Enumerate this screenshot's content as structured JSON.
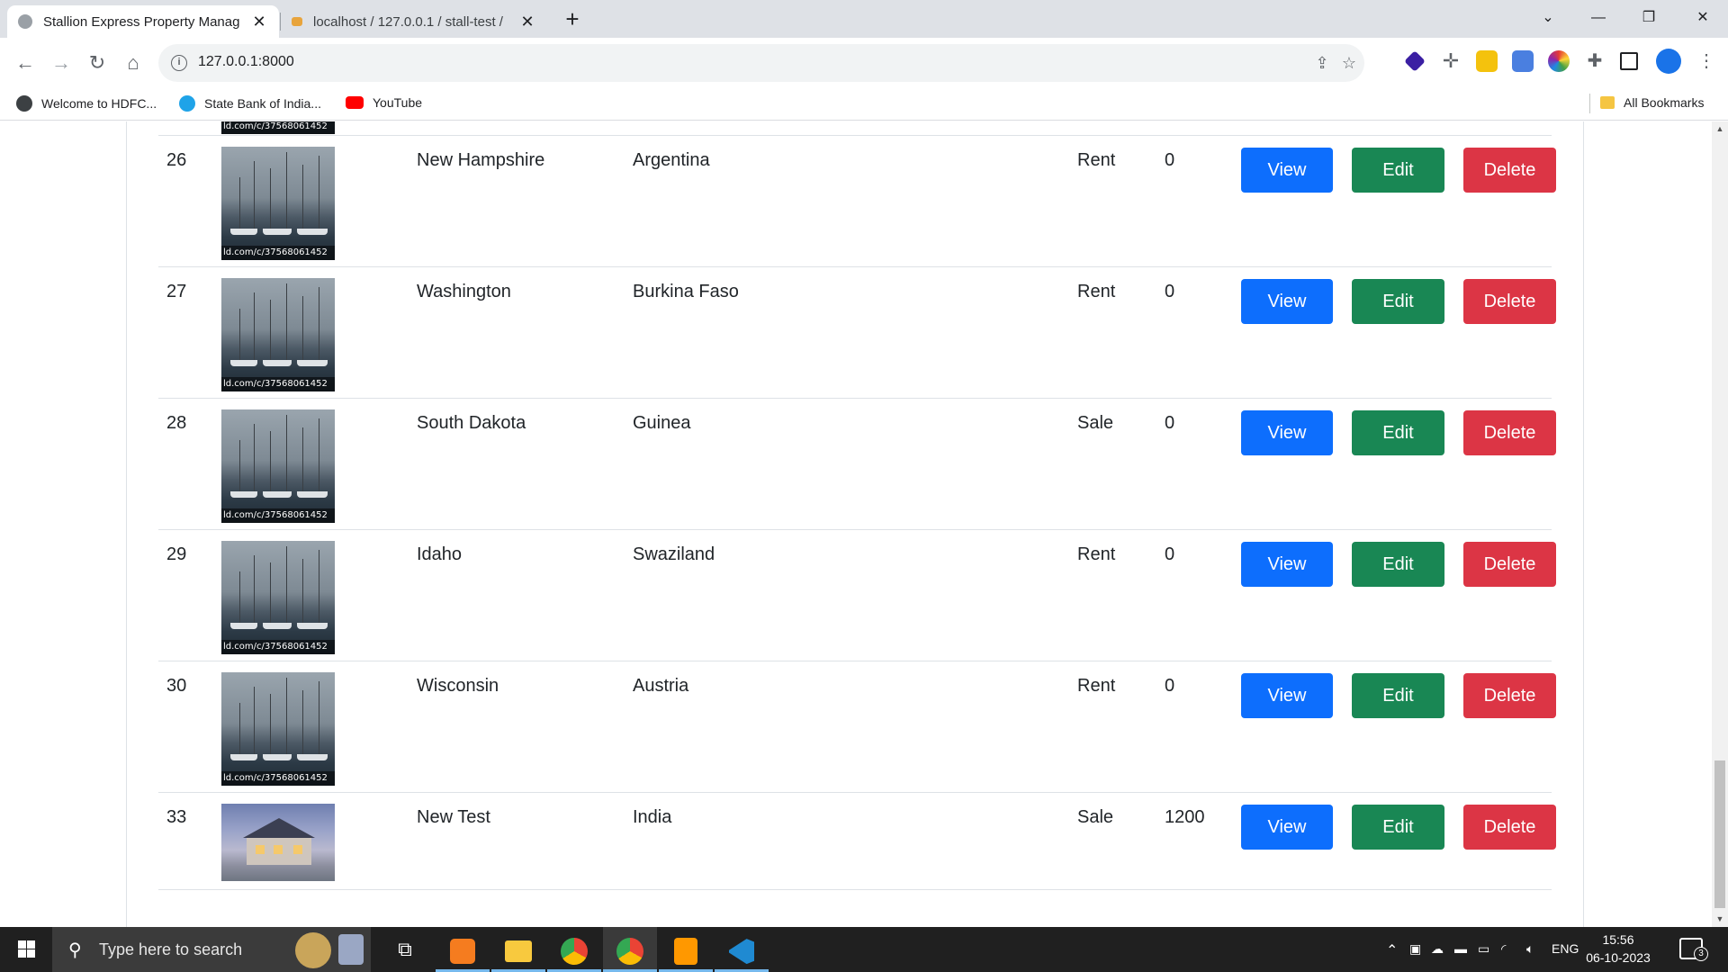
{
  "browser": {
    "tabs": [
      {
        "title": "Stallion Express Property Manag",
        "active": true
      },
      {
        "title": "localhost / 127.0.0.1 / stall-test /",
        "active": false
      }
    ],
    "url": "127.0.0.1:8000",
    "bookmarks": [
      {
        "label": "Welcome to HDFC...",
        "icon": "globe-icon"
      },
      {
        "label": "State Bank of India...",
        "icon": "sbi-icon"
      },
      {
        "label": "YouTube",
        "icon": "youtube-icon"
      }
    ],
    "all_bookmarks": "All Bookmarks"
  },
  "table": {
    "rows": [
      {
        "id": "26",
        "state": "New Hampshire",
        "country": "Argentina",
        "type": "Rent",
        "price": "0",
        "image_caption": "ld.com/c/37568061452"
      },
      {
        "id": "27",
        "state": "Washington",
        "country": "Burkina Faso",
        "type": "Rent",
        "price": "0",
        "image_caption": "ld.com/c/37568061452"
      },
      {
        "id": "28",
        "state": "South Dakota",
        "country": "Guinea",
        "type": "Sale",
        "price": "0",
        "image_caption": "ld.com/c/37568061452"
      },
      {
        "id": "29",
        "state": "Idaho",
        "country": "Swaziland",
        "type": "Rent",
        "price": "0",
        "image_caption": "ld.com/c/37568061452"
      },
      {
        "id": "30",
        "state": "Wisconsin",
        "country": "Austria",
        "type": "Rent",
        "price": "0",
        "image_caption": "ld.com/c/37568061452"
      },
      {
        "id": "33",
        "state": "New Test",
        "country": "India",
        "type": "Sale",
        "price": "1200",
        "image_caption": ""
      }
    ],
    "actions": {
      "view": "View",
      "edit": "Edit",
      "delete": "Delete"
    },
    "colors": {
      "view": "#0d6efd",
      "edit": "#198754",
      "delete": "#dc3545"
    }
  },
  "taskbar": {
    "search_placeholder": "Type here to search",
    "language": "ENG",
    "time": "15:56",
    "date": "06-10-2023",
    "notification_count": "3",
    "apps": [
      "task-view-icon",
      "xampp-icon",
      "file-explorer-icon",
      "chrome-icon",
      "chrome-profile-icon",
      "sublime-text-icon",
      "vscode-icon"
    ]
  }
}
